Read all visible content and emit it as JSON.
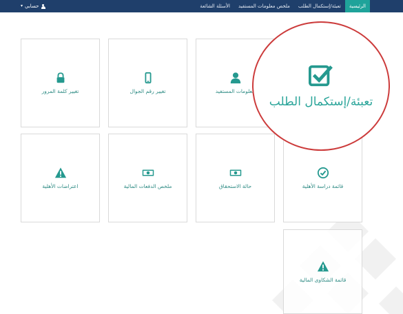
{
  "nav": {
    "items": [
      {
        "label": "الرئيسية",
        "active": true
      },
      {
        "label": "تعبئة/إستكمال الطلب"
      },
      {
        "label": "ملخص معلومات المستفيد"
      },
      {
        "label": "الأسئلة الشائعة"
      }
    ],
    "account_label": "حسابي"
  },
  "tiles": [
    {
      "label": "معلومات المستفيد",
      "icon": "user-icon"
    },
    {
      "label": "تغيير رقم الجوال",
      "icon": "mobile-icon"
    },
    {
      "label": "تغيير كلمة المرور",
      "icon": "lock-icon"
    },
    {
      "label": "قائمة دراسة الأهلية",
      "icon": "check-circle-icon"
    },
    {
      "label": "حالة الاستحقاق",
      "icon": "money-icon"
    },
    {
      "label": "ملخص الدفعات المالية",
      "icon": "money-icon"
    },
    {
      "label": "اعتراضات الأهلية",
      "icon": "warning-icon"
    },
    {
      "label": "قائمة الشكاوى المالية",
      "icon": "warning-icon"
    }
  ],
  "highlight": {
    "label": "تعبئة/إستكمال الطلب",
    "icon": "checkbox-icon"
  },
  "colors": {
    "navbar": "#1f3f6b",
    "accent": "#1fa39a",
    "icon": "#25998f",
    "callout_border": "#cc3b3b"
  }
}
